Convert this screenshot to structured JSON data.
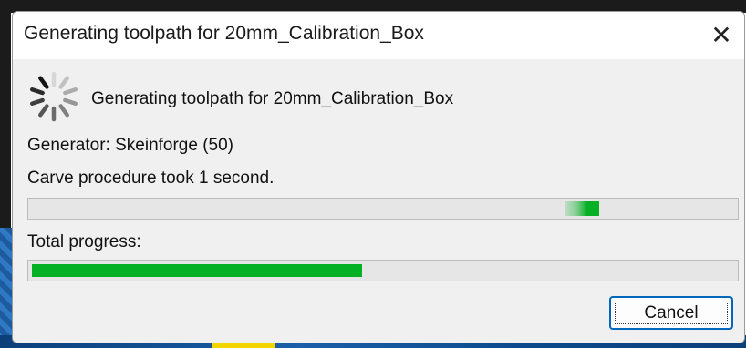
{
  "window": {
    "title": "Generating toolpath for 20mm_Calibration_Box",
    "close_glyph": "✕"
  },
  "status": {
    "message": "Generating toolpath for 20mm_Calibration_Box",
    "generator": "Generator: Skeinforge (50)",
    "step": "Carve procedure took 1 second.",
    "icon": "spinner-icon"
  },
  "progress": {
    "step_mode": "indeterminate",
    "total_label": "Total progress:",
    "total_fraction": 0.47,
    "color": "#06b025"
  },
  "buttons": {
    "cancel_label": "Cancel"
  },
  "colors": {
    "accent": "#0067c0",
    "progress_green": "#06b025",
    "dialog_bg": "#f0f0f0"
  }
}
